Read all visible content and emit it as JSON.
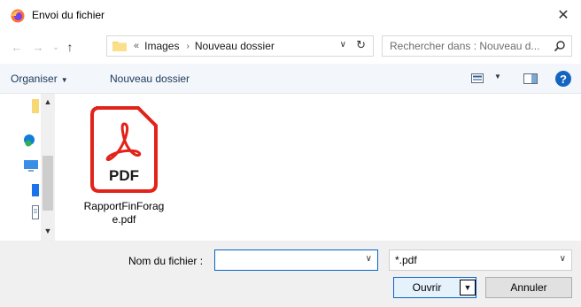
{
  "window": {
    "title": "Envoi du fichier",
    "app_icon": "firefox-icon",
    "close_glyph": "✕"
  },
  "address": {
    "overflow": "«",
    "crumbs": [
      "Images",
      "Nouveau dossier"
    ],
    "separator": "›"
  },
  "search": {
    "placeholder": "Rechercher dans : Nouveau d..."
  },
  "toolbar": {
    "organise_label": "Organiser",
    "new_folder_label": "Nouveau dossier",
    "help_label": "?"
  },
  "files": [
    {
      "name": "RapportFinForage.pdf",
      "icon": "pdf-file-icon",
      "icon_text": "PDF"
    }
  ],
  "footer": {
    "filename_label": "Nom du fichier :",
    "filename_value": "",
    "filter_value": "*.pdf",
    "open_label": "Ouvrir",
    "cancel_label": "Annuler"
  },
  "colors": {
    "accent": "#0a64c8",
    "pdf_red": "#e2231a",
    "folder_yellow": "#f8d775",
    "toolbar_bg": "#f3f6fa",
    "footer_bg": "#f0f0f0"
  }
}
